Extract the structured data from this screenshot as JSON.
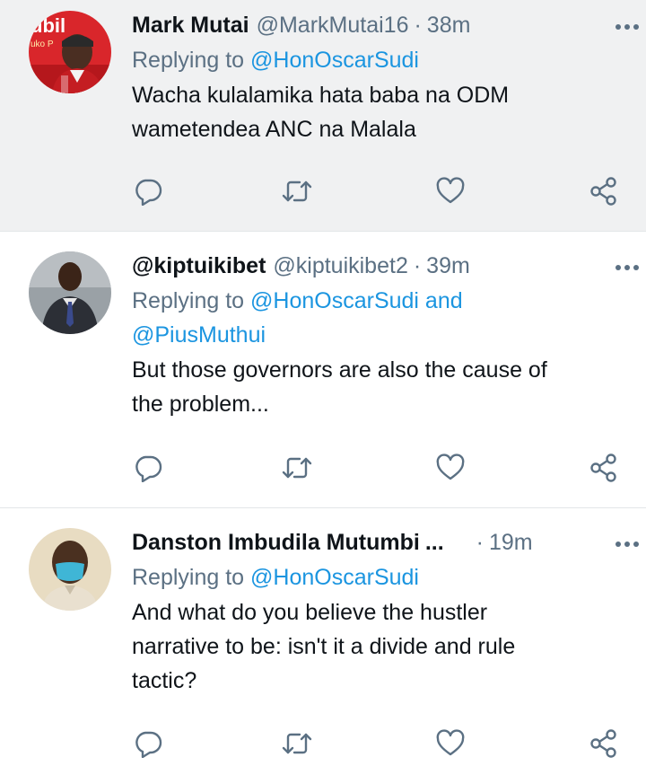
{
  "tweets": [
    {
      "name": "Mark Mutai",
      "handle": "@MarkMutai16",
      "separator": "·",
      "time": "38m",
      "replying_prefix": "Replying to ",
      "mentions": [
        "@HonOscarSudi"
      ],
      "text_lines": [
        "Wacha kulalamika hata baba na ODM",
        "wametendea ANC na Malala"
      ],
      "avatar_text": "ubil",
      "avatar_subtext": "uko P"
    },
    {
      "name": "@kiptuikibet",
      "handle": "@kiptuikibet2",
      "separator": "·",
      "time": "39m",
      "replying_prefix": "Replying to ",
      "mentions": [
        "@HonOscarSudi",
        "@PiusMuthui"
      ],
      "mention_joiner": " and",
      "text_lines": [
        "But those governors are also the cause of",
        "the problem..."
      ]
    },
    {
      "name": "Danston Imbudila Mutumbi",
      "name_ellipsis": "...",
      "separator": "·",
      "time": "19m",
      "replying_prefix": "Replying to ",
      "mentions": [
        "@HonOscarSudi"
      ],
      "text_lines": [
        "And what do you believe the hustler",
        "narrative to be: isn't it a divide and rule",
        "tactic?"
      ]
    }
  ],
  "icons": {
    "reply": "reply-bubble-icon",
    "retweet": "retweet-icon",
    "like": "heart-icon",
    "share": "share-icon",
    "more": "more-dots-icon"
  },
  "colors": {
    "mention": "#1b95e0",
    "secondary": "#5b7083",
    "highlight_bg": "#f0f1f2",
    "icon": "#5b7083"
  }
}
